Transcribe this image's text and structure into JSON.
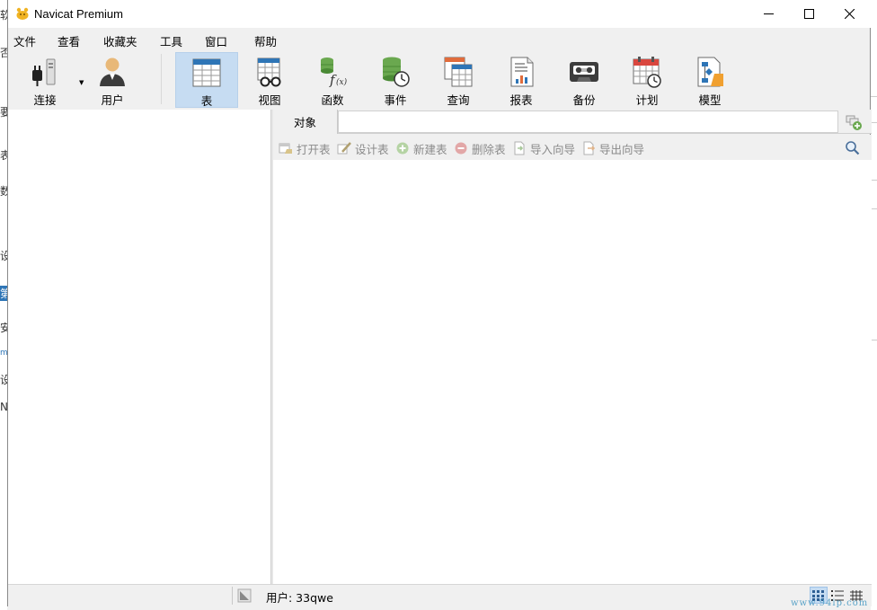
{
  "window": {
    "title": "Navicat Premium"
  },
  "menu": [
    "文件",
    "查看",
    "收藏夹",
    "工具",
    "窗口",
    "帮助"
  ],
  "toolbar": {
    "connect": "连接",
    "user": "用户",
    "table": "表",
    "view": "视图",
    "function": "函数",
    "event": "事件",
    "query": "查询",
    "report": "报表",
    "backup": "备份",
    "schedule": "计划",
    "model": "模型"
  },
  "tabs": {
    "objects": "对象"
  },
  "object_toolbar": {
    "open_table": "打开表",
    "design_table": "设计表",
    "new_table": "新建表",
    "delete_table": "删除表",
    "import_wizard": "导入向导",
    "export_wizard": "导出向导"
  },
  "status": {
    "user": "用户: 33qwe"
  },
  "watermark": "www.94ip.com",
  "background": {
    "fragments": [
      "软",
      "否",
      "要",
      "表",
      "数",
      "设",
      "第",
      "安",
      "m",
      "设",
      "N"
    ]
  },
  "colors": {
    "active_tool": "#c6dcf2",
    "accent_green": "#6aa84f",
    "accent_blue": "#2e75b6"
  }
}
